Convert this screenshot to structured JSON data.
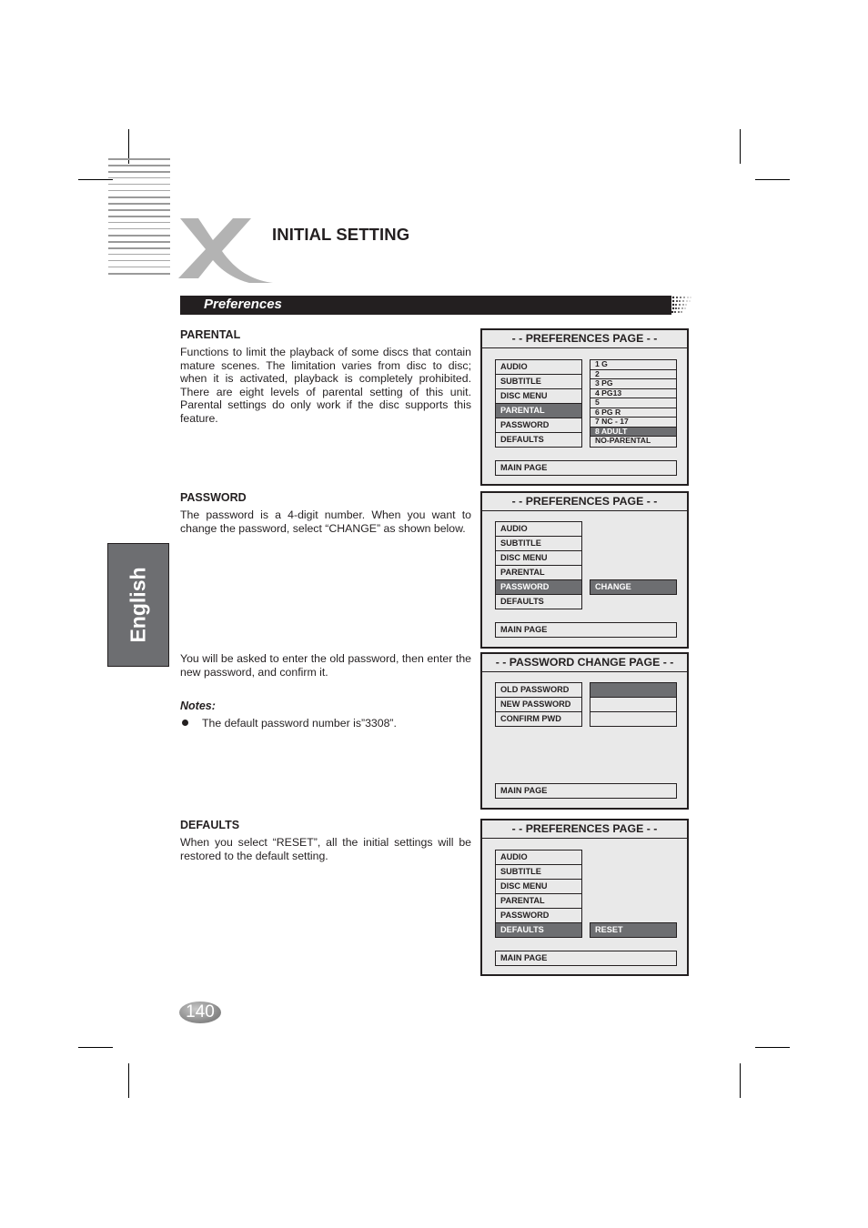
{
  "header": {
    "title": "INITIAL SETTING",
    "logo": "xoro-x-logo"
  },
  "section_banner": "Preferences",
  "side_tab": "English",
  "sections": {
    "parental": {
      "heading": "PARENTAL",
      "body": "Functions to limit the playback of some discs that contain mature scenes. The limitation varies from disc to disc; when it is activated, playback is completely prohibited. There are eight levels of parental setting of this unit. Parental settings do only work if the disc supports this feature."
    },
    "password": {
      "heading": "PASSWORD",
      "body": "The password is a 4-digit number. When you want to change the password, select “CHANGE” as shown below.",
      "body2": "You will be asked to enter the old password, then enter the new password, and confirm it.",
      "notes_heading": "Notes:",
      "notes": [
        "The default password number is”3308”."
      ]
    },
    "defaults": {
      "heading": "DEFAULTS",
      "body": "When you select “RESET”, all the initial settings will be restored to the default setting."
    }
  },
  "osd_screens": [
    {
      "title": "- - PREFERENCES PAGE - -",
      "menu": [
        "AUDIO",
        "SUBTITLE",
        "DISC MENU",
        "PARENTAL",
        "PASSWORD",
        "DEFAULTS"
      ],
      "selected": "PARENTAL",
      "options": [
        "1  G",
        "2",
        "3  PG",
        "4  PG13",
        "5",
        "6 PG  R",
        "7  NC - 17",
        "8  ADULT",
        "NO-PARENTAL"
      ],
      "selected_option": "8  ADULT",
      "footer": "MAIN PAGE"
    },
    {
      "title": "- - PREFERENCES PAGE - -",
      "menu": [
        "AUDIO",
        "SUBTITLE",
        "DISC MENU",
        "PARENTAL",
        "PASSWORD",
        "DEFAULTS"
      ],
      "selected": "PASSWORD",
      "option": "CHANGE",
      "footer": "MAIN PAGE"
    },
    {
      "title": "- - PASSWORD CHANGE PAGE - -",
      "fields": [
        "OLD PASSWORD",
        "NEW PASSWORD",
        "CONFIRM PWD"
      ],
      "active_field": "OLD PASSWORD",
      "footer": "MAIN PAGE"
    },
    {
      "title": "- - PREFERENCES PAGE - -",
      "menu": [
        "AUDIO",
        "SUBTITLE",
        "DISC MENU",
        "PARENTAL",
        "PASSWORD",
        "DEFAULTS"
      ],
      "selected": "DEFAULTS",
      "option": "RESET",
      "footer": "MAIN PAGE"
    }
  ],
  "page_number": "140",
  "colors": {
    "text": "#231f20",
    "highlight": "#6d6e71",
    "osd_bg": "#e9e9e9",
    "logo_gray": "#b3b3b3"
  }
}
